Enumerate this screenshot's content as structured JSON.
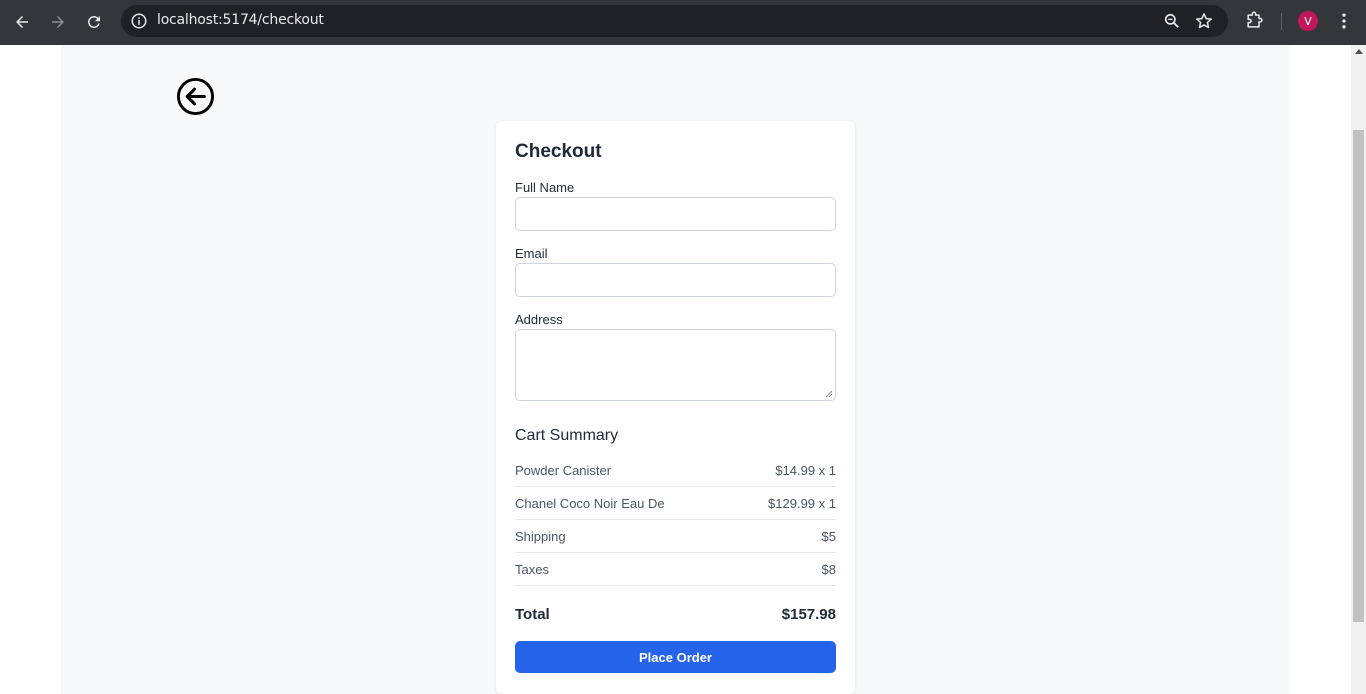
{
  "browser": {
    "url": "localhost:5174/checkout",
    "profile_initial": "V",
    "profile_color": "#c2185b"
  },
  "checkout": {
    "title": "Checkout",
    "full_name_label": "Full Name",
    "email_label": "Email",
    "address_label": "Address",
    "full_name_value": "",
    "email_value": "",
    "address_value": ""
  },
  "cart_summary": {
    "title": "Cart Summary",
    "items": [
      {
        "name": "Powder Canister",
        "price": "$14.99 x 1"
      },
      {
        "name": "Chanel Coco Noir Eau De",
        "price": "$129.99 x 1"
      }
    ],
    "shipping_label": "Shipping",
    "shipping_value": "$5",
    "taxes_label": "Taxes",
    "taxes_value": "$8",
    "total_label": "Total",
    "total_value": "$157.98"
  },
  "actions": {
    "place_order_label": "Place Order"
  },
  "colors": {
    "accent": "#2563eb",
    "page_bg": "#f7f8fa",
    "chrome_bg": "#35363a"
  }
}
